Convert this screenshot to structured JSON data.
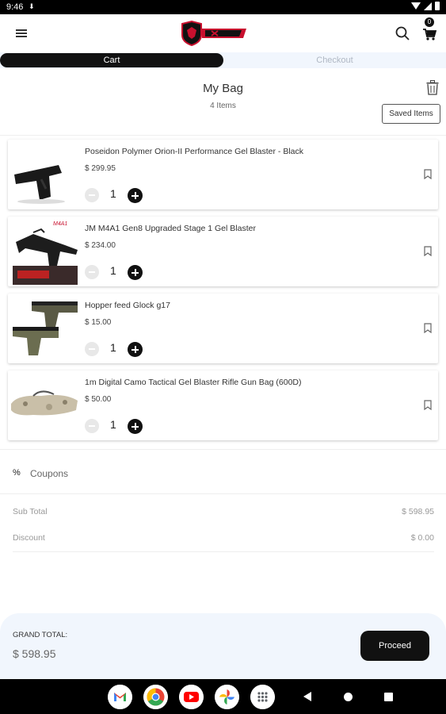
{
  "status_bar": {
    "time": "9:46"
  },
  "header": {
    "cart_count": "0"
  },
  "tabs": {
    "cart": "Cart",
    "checkout": "Checkout"
  },
  "bag": {
    "title": "My Bag",
    "count": "4 Items",
    "saved_items_label": "Saved Items"
  },
  "items": [
    {
      "name": "Poseidon Polymer Orion-II Performance Gel Blaster - Black",
      "price": "$ 299.95",
      "qty": "1"
    },
    {
      "name": "JM M4A1 Gen8 Upgraded Stage 1 Gel Blaster",
      "price": "$ 234.00",
      "qty": "1",
      "thumb_text": "M4A1"
    },
    {
      "name": "Hopper feed Glock g17",
      "price": "$ 15.00",
      "qty": "1"
    },
    {
      "name": "1m Digital Camo Tactical Gel Blaster Rifle Gun Bag (600D)",
      "price": "$ 50.00",
      "qty": "1"
    }
  ],
  "coupons": {
    "icon": "%",
    "label": "Coupons"
  },
  "summary": {
    "subtotal_label": "Sub Total",
    "subtotal_value": "$ 598.95",
    "discount_label": "Discount",
    "discount_value": "$ 0.00"
  },
  "footer": {
    "grand_total_label": "GRAND TOTAL:",
    "grand_total_value": "$ 598.95",
    "proceed_label": "Proceed"
  },
  "colors": {
    "primary": "#111111",
    "tab_bg": "#f1f6fd",
    "muted": "#999999"
  },
  "icons": [
    "menu-icon",
    "search-icon",
    "cart-icon",
    "trash-icon",
    "bookmark-icon",
    "minus-icon",
    "plus-icon",
    "percent-icon"
  ]
}
